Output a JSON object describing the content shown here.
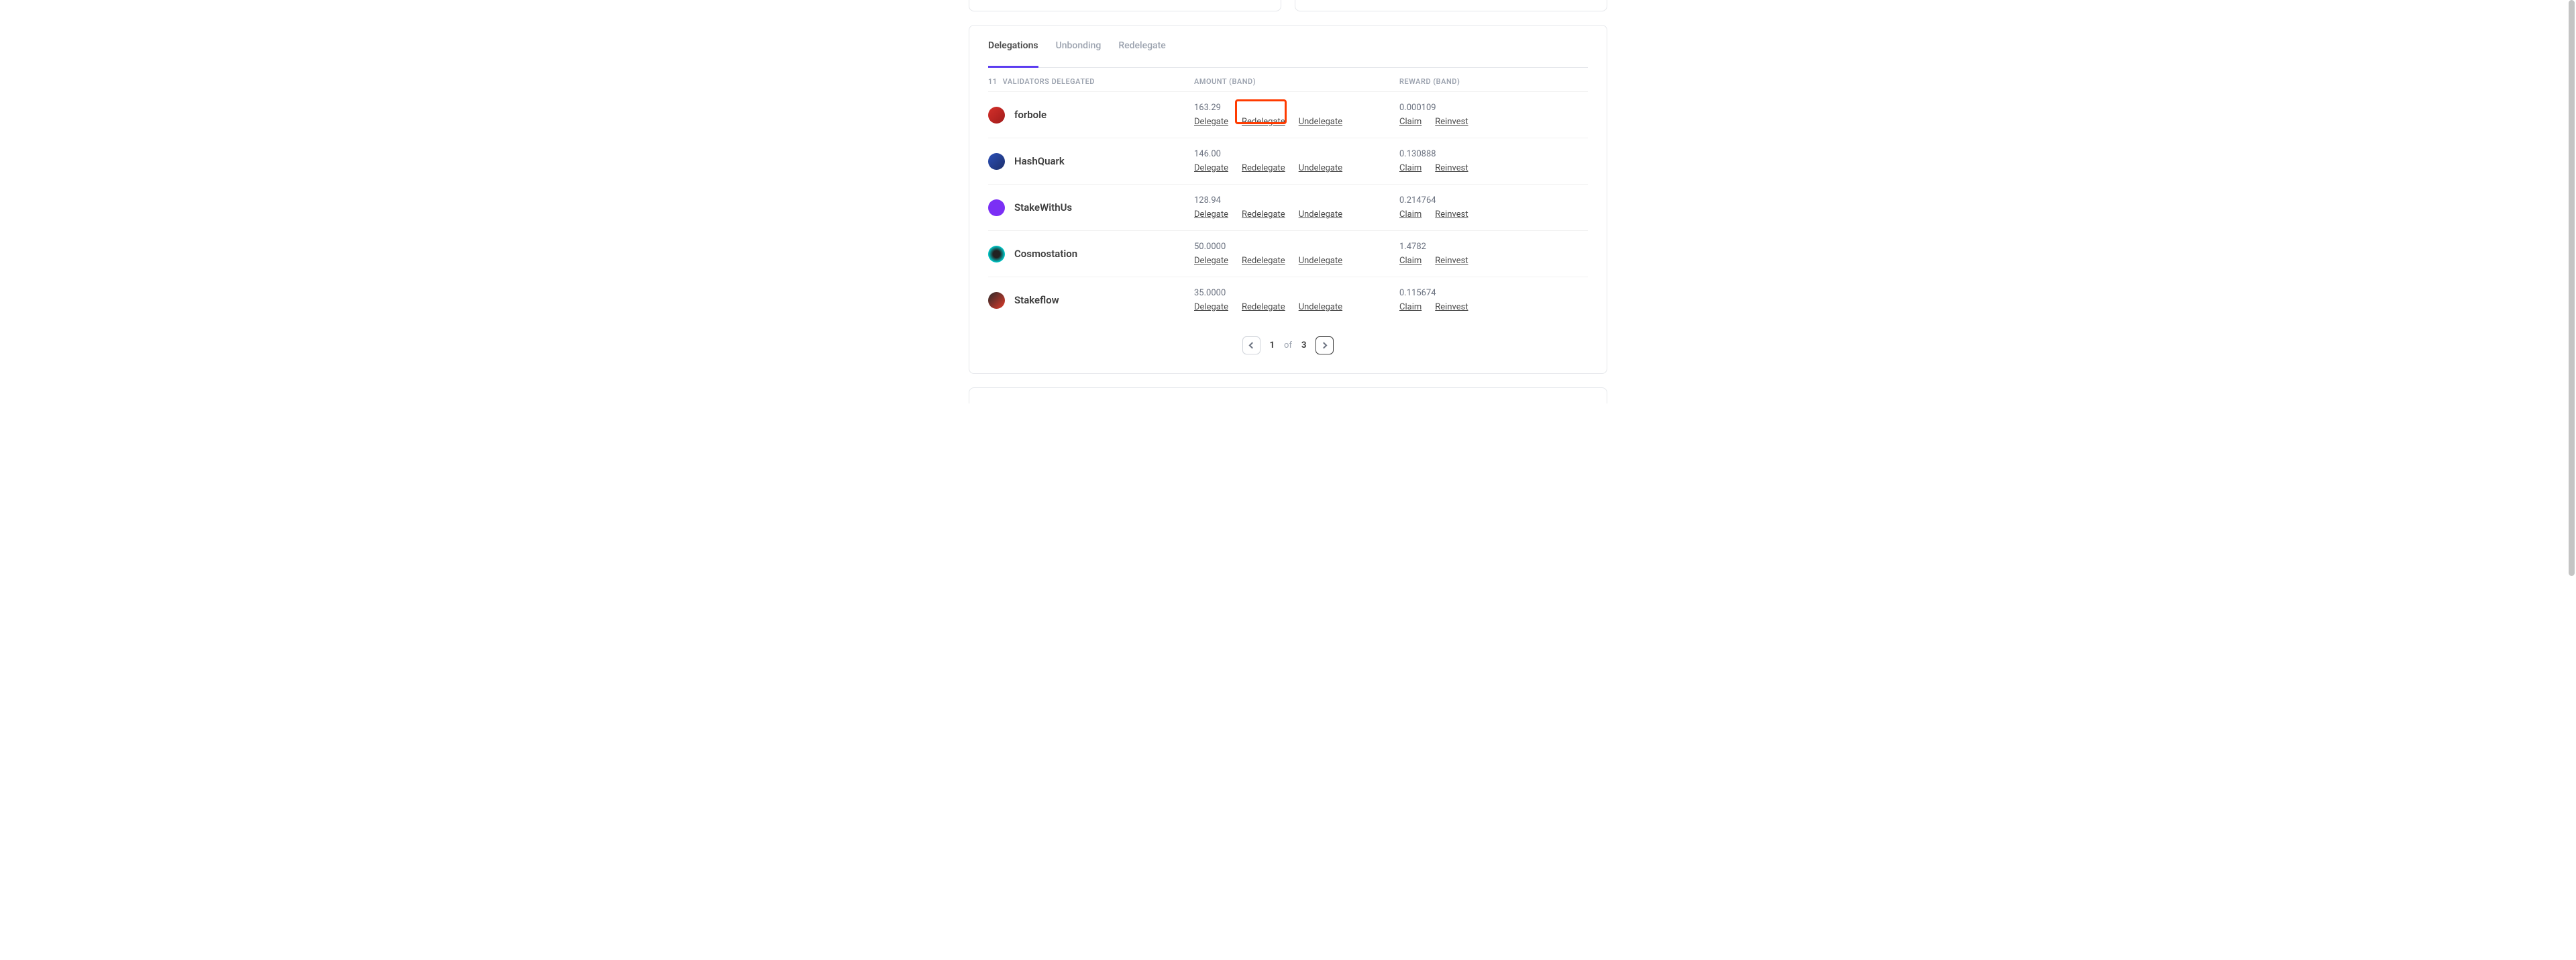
{
  "tabs": [
    {
      "label": "Delegations",
      "active": true
    },
    {
      "label": "Unbonding",
      "active": false
    },
    {
      "label": "Redelegate",
      "active": false
    }
  ],
  "headers": {
    "count": "11",
    "count_label": "VALIDATORS DELEGATED",
    "amount": "AMOUNT (BAND)",
    "reward": "REWARD (BAND)"
  },
  "validators": [
    {
      "name": "forbole",
      "icon_bg": "linear-gradient(135deg,#d5302a,#a01b1b)",
      "amount": "163.29",
      "reward": "0.000109",
      "highlight_redelegate": true
    },
    {
      "name": "HashQuark",
      "icon_bg": "linear-gradient(135deg,#2b4fb8,#1d2f6b)",
      "amount": "146.00",
      "reward": "0.130888",
      "highlight_redelegate": false
    },
    {
      "name": "StakeWithUs",
      "icon_bg": "#7b2ff5",
      "amount": "128.94",
      "reward": "0.214764",
      "highlight_redelegate": false
    },
    {
      "name": "Cosmostation",
      "icon_bg": "radial-gradient(circle,#222 30%,#0cc 70%,#222 100%)",
      "amount": "50.0000",
      "reward": "1.4782",
      "highlight_redelegate": false
    },
    {
      "name": "Stakeflow",
      "icon_bg": "linear-gradient(135deg,#2a2a2a,#e03a2a)",
      "amount": "35.0000",
      "reward": "0.115674",
      "highlight_redelegate": false
    }
  ],
  "action_labels": {
    "delegate": "Delegate",
    "redelegate": "Redelegate",
    "undelegate": "Undelegate",
    "claim": "Claim",
    "reinvest": "Reinvest"
  },
  "pagination": {
    "current": "1",
    "of": "of",
    "total": "3"
  }
}
